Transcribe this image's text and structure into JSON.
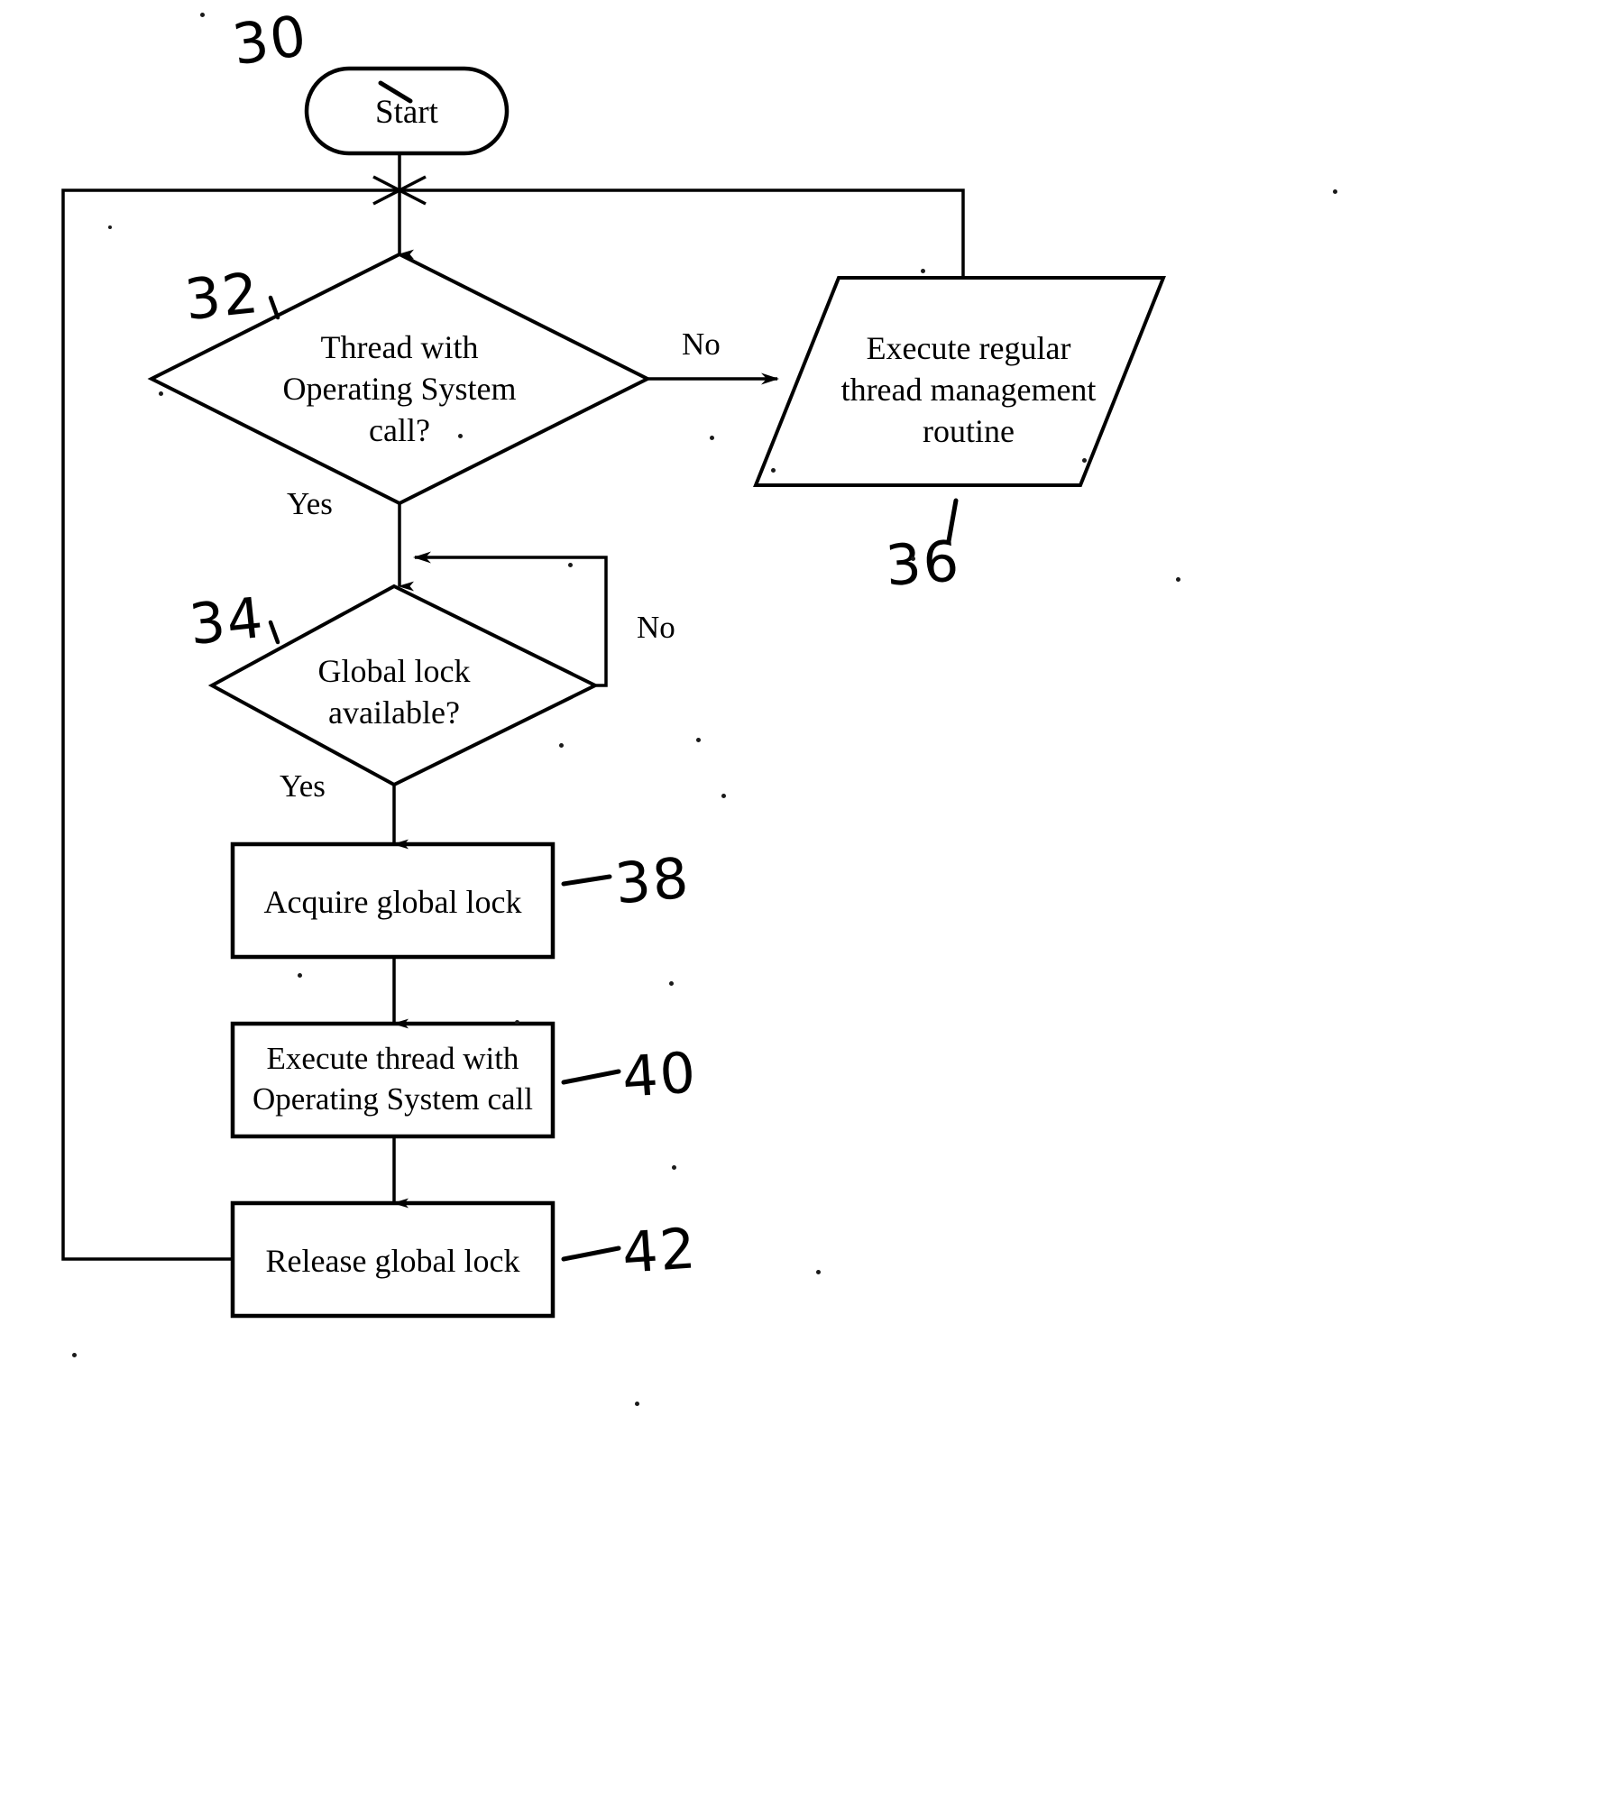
{
  "diagram": {
    "title": "Thread management flowchart",
    "type": "flowchart",
    "line_color": "#000000",
    "background_color": "#ffffff"
  },
  "nodes": {
    "start": {
      "shape": "terminator",
      "label": "Start",
      "ref": "30"
    },
    "decision_os_call": {
      "shape": "diamond",
      "label": "Thread with\nOperating System\ncall?",
      "ref": "32"
    },
    "regular_routine": {
      "shape": "parallelogram",
      "label": "Execute regular\nthread management\nroutine",
      "ref": "36"
    },
    "decision_lock": {
      "shape": "diamond",
      "label": "Global lock\navailable?",
      "ref": "34"
    },
    "acquire_lock": {
      "shape": "rectangle",
      "label": "Acquire global lock",
      "ref": "38"
    },
    "execute_thread": {
      "shape": "rectangle",
      "label": "Execute thread with\nOperating System call",
      "ref": "40"
    },
    "release_lock": {
      "shape": "rectangle",
      "label": "Release global lock",
      "ref": "42"
    }
  },
  "edge_labels": {
    "os_call_no": "No",
    "os_call_yes": "Yes",
    "lock_no": "No",
    "lock_yes": "Yes"
  },
  "reference_numerals": {
    "start": "30",
    "decision_os_call": "32",
    "decision_lock": "34",
    "regular_routine": "36",
    "acquire_lock": "38",
    "execute_thread": "40",
    "release_lock": "42"
  }
}
